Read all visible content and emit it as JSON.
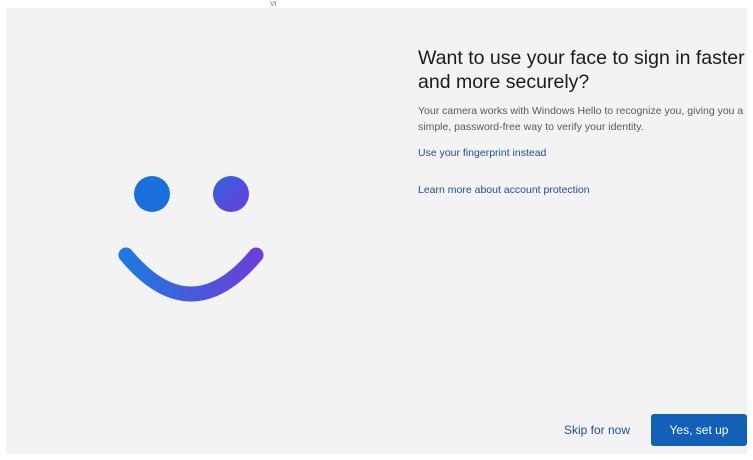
{
  "top_mark": "Vt",
  "illustration": {
    "icon": "windows-hello-face-icon",
    "colors": {
      "left_eye": "#1a6fdc",
      "right_eye_start": "#2f63e0",
      "right_eye_end": "#6a3fd8",
      "smile_start": "#1f78e0",
      "smile_end": "#6a3fd8"
    }
  },
  "dialog": {
    "title": "Want to use your face to sign in faster and more securely?",
    "description": "Your camera works with Windows Hello to recognize you, giving you a simple, password-free way to verify your identity.",
    "fingerprint_link": "Use your fingerprint instead",
    "learn_more_link": "Learn more about account protection"
  },
  "actions": {
    "skip_label": "Skip for now",
    "setup_label": "Yes, set up"
  },
  "colors": {
    "background": "#f3f3f3",
    "accent": "#1260b8",
    "link": "#1d4f91"
  }
}
